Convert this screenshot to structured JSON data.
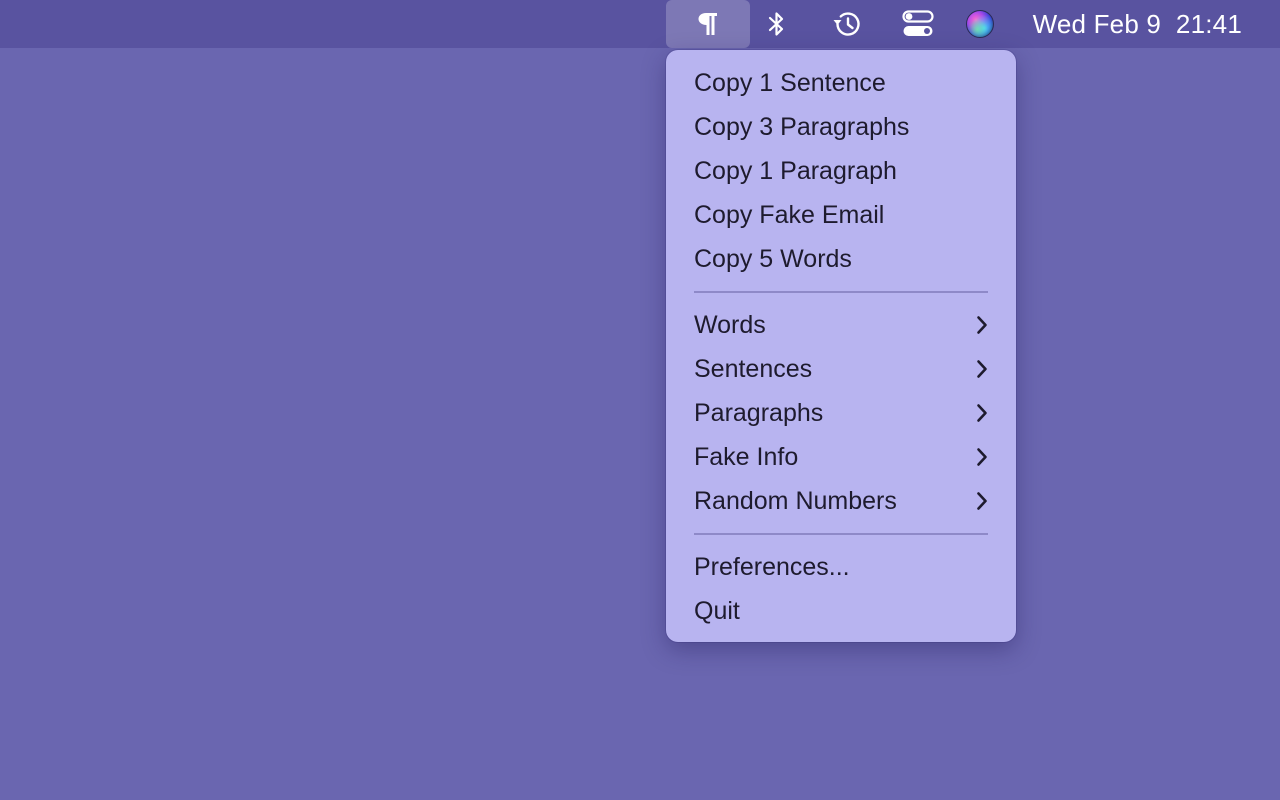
{
  "menubar": {
    "clock": {
      "date": "Wed Feb 9",
      "time": "21:41"
    },
    "icons": [
      "pilcrow-icon",
      "bluetooth-icon",
      "time-machine-icon",
      "control-center-icon",
      "siri-icon"
    ]
  },
  "menu": {
    "group1": [
      {
        "label": "Copy 1 Sentence"
      },
      {
        "label": "Copy 3 Paragraphs"
      },
      {
        "label": "Copy 1 Paragraph"
      },
      {
        "label": "Copy Fake Email"
      },
      {
        "label": "Copy 5 Words"
      }
    ],
    "group2": [
      {
        "label": "Words"
      },
      {
        "label": "Sentences"
      },
      {
        "label": "Paragraphs"
      },
      {
        "label": "Fake Info"
      },
      {
        "label": "Random Numbers"
      }
    ],
    "group3": [
      {
        "label": "Preferences..."
      },
      {
        "label": "Quit"
      }
    ]
  },
  "colors": {
    "desktop": "#6a66b0",
    "menubar": "#5953a0",
    "menu_background": "#b8b4f0",
    "menu_text": "#1e1b2e"
  }
}
